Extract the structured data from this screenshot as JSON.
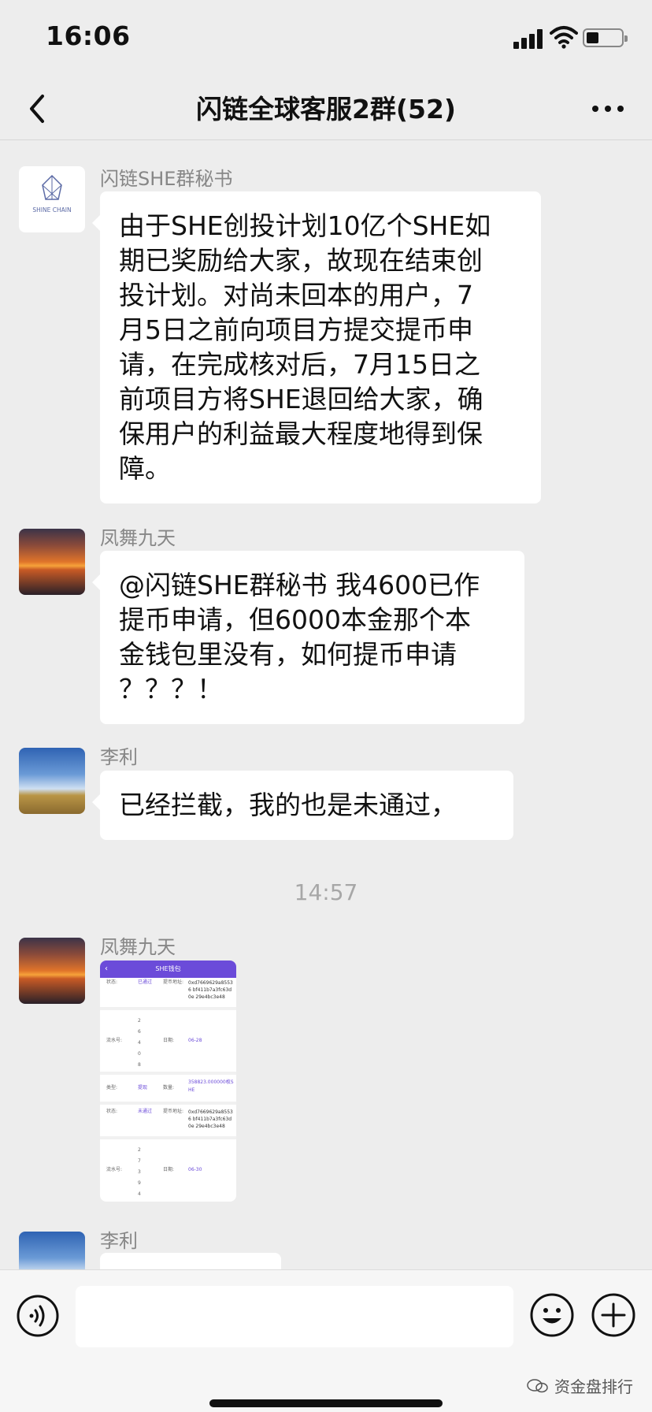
{
  "status_bar": {
    "time": "16:06"
  },
  "nav": {
    "title": "闪链全球客服2群(52)"
  },
  "messages": [
    {
      "sender": "闪链SHE群秘书",
      "avatar_text": "SHINE CHAIN",
      "lines": [
        "由于SHE创投计划10亿个SHE如",
        "期已奖励给大家，故现在结束创",
        "投计划。对尚未回本的用户，7",
        "月5日之前向项目方提交提币申",
        "请，在完成核对后，7月15日之",
        "前项目方将SHE退回给大家，确",
        "保用户的利益最大程度地得到保",
        "障。"
      ]
    },
    {
      "sender": "凤舞九天",
      "lines": [
        "@闪链SHE群秘书 我4600已作",
        "提币申请，但6000本金那个本",
        "金钱包里没有，如何提币申请",
        "？？？！"
      ]
    },
    {
      "sender": "李利",
      "lines": [
        "已经拦截，我的也是未通过，"
      ]
    },
    {
      "sender": "凤舞九天",
      "image": {
        "header": "SHE钱包",
        "rows": [
          [
            "状态:",
            "已通过",
            "提币地址:",
            "0xd7669629a85536 bf411b7a3fc63d0e 29e4bc3e48"
          ],
          [
            "流水号:",
            "2 6 4 0 8",
            "日期:",
            "06-28"
          ],
          [
            "类型:",
            "提现",
            "数量:",
            "358823.000000枚SHE"
          ],
          [
            "状态:",
            "未通过",
            "提币地址:",
            "0xd7669629a85536 bf411b7a3fc63d0e 29e4bc3e48"
          ],
          [
            "流水号:",
            "2 7 3 9 4",
            "日期:",
            "06-30"
          ]
        ]
      }
    },
    {
      "sender": "李利"
    }
  ],
  "timestamp": "14:57",
  "watermark": "资金盘排行",
  "colors": {
    "background": "#ededed",
    "bubble": "#ffffff",
    "sender": "#878787",
    "accent": "#6b4bd9"
  }
}
